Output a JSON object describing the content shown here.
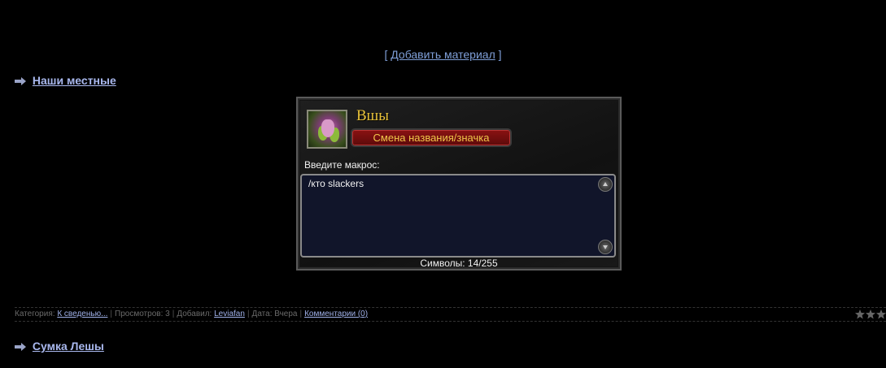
{
  "add_material": {
    "open_bracket": "[",
    "link": "Добавить материал",
    "close_bracket": "]"
  },
  "posts": [
    {
      "title": "Наши местные",
      "image": {
        "character_name": "Вшы",
        "rename_button": "Смена названия/значка",
        "macro_label": "Введите макрос:",
        "macro_text": "/кто slackers",
        "char_count": "Символы: 14/255"
      },
      "meta": {
        "category_label": "Категория:",
        "category_value": "К сведенью...",
        "views_label": "Просмотров:",
        "views_value": "3",
        "added_label": "Добавил:",
        "added_value": "Leviafan",
        "date_label": "Дата:",
        "date_value": "Вчера",
        "comments": "Комментарии (0)",
        "rating_stars": 3
      }
    },
    {
      "title": "Сумка Лешы"
    }
  ],
  "colors": {
    "link": "#a9b8ee",
    "meta_text": "#6a6a6a",
    "wow_gold": "#e8c23a",
    "wow_red": "#8a1212"
  }
}
